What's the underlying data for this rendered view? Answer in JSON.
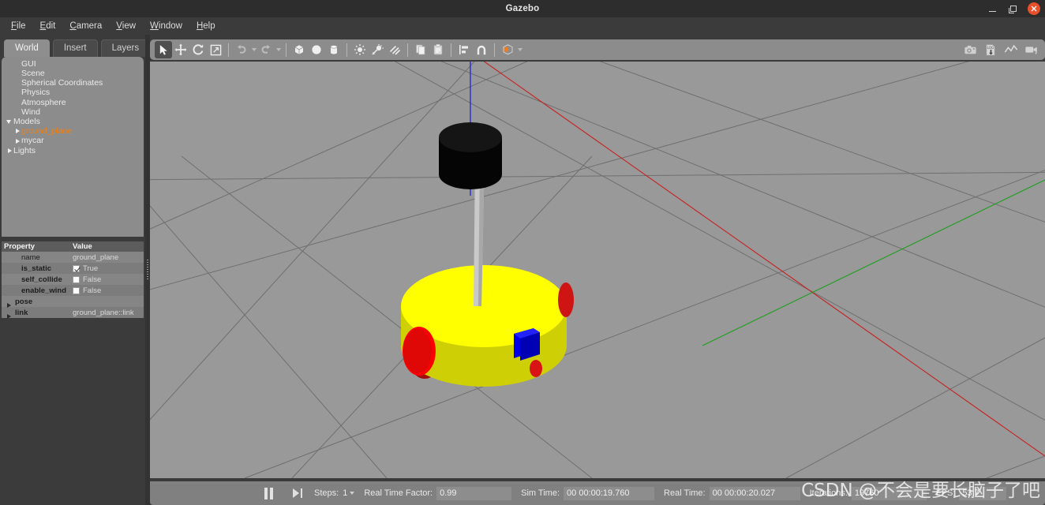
{
  "window": {
    "title": "Gazebo",
    "minimize_label": "Minimize",
    "maximize_label": "Maximize",
    "close_label": "Close"
  },
  "menu": {
    "items": [
      {
        "label": "File"
      },
      {
        "label": "Edit"
      },
      {
        "label": "Camera"
      },
      {
        "label": "View"
      },
      {
        "label": "Window"
      },
      {
        "label": "Help"
      }
    ]
  },
  "sidebar": {
    "tabs": [
      {
        "label": "World",
        "active": true
      },
      {
        "label": "Insert",
        "active": false
      },
      {
        "label": "Layers",
        "active": false
      }
    ],
    "tree": [
      {
        "label": "GUI",
        "indent": 1,
        "arrow": "none",
        "selected": false
      },
      {
        "label": "Scene",
        "indent": 1,
        "arrow": "none",
        "selected": false
      },
      {
        "label": "Spherical Coordinates",
        "indent": 1,
        "arrow": "none",
        "selected": false
      },
      {
        "label": "Physics",
        "indent": 1,
        "arrow": "none",
        "selected": false
      },
      {
        "label": "Atmosphere",
        "indent": 1,
        "arrow": "none",
        "selected": false
      },
      {
        "label": "Wind",
        "indent": 1,
        "arrow": "none",
        "selected": false
      },
      {
        "label": "Models",
        "indent": 0,
        "arrow": "down",
        "selected": false
      },
      {
        "label": "ground_plane",
        "indent": 1,
        "arrow": "right",
        "selected": true
      },
      {
        "label": "mycar",
        "indent": 1,
        "arrow": "right",
        "selected": false
      },
      {
        "label": "Lights",
        "indent": 0,
        "arrow": "right",
        "selected": false
      }
    ],
    "property_headers": {
      "property": "Property",
      "value": "Value"
    },
    "properties": [
      {
        "name": "name",
        "value": "ground_plane",
        "kind": "text",
        "bold": false
      },
      {
        "name": "is_static",
        "value": "True",
        "kind": "check",
        "checked": true,
        "bold": true
      },
      {
        "name": "self_collide",
        "value": "False",
        "kind": "check",
        "checked": false,
        "bold": true
      },
      {
        "name": "enable_wind",
        "value": "False",
        "kind": "check",
        "checked": false,
        "bold": true
      },
      {
        "name": "pose",
        "value": "",
        "kind": "expand",
        "bold": true
      },
      {
        "name": "link",
        "value": "ground_plane::link",
        "kind": "expand",
        "bold": true
      }
    ]
  },
  "toolbar": {
    "left_tools": [
      {
        "name": "select-mode",
        "icon": "cursor-arrow-icon",
        "active": true
      },
      {
        "name": "translate-mode",
        "icon": "move-arrows-icon",
        "active": false
      },
      {
        "name": "rotate-mode",
        "icon": "rotate-icon",
        "active": false
      },
      {
        "name": "scale-mode",
        "icon": "scale-icon",
        "active": false
      }
    ],
    "history_tools": [
      {
        "name": "undo",
        "icon": "undo-arrow-icon"
      },
      {
        "name": "redo",
        "icon": "redo-arrow-icon"
      }
    ],
    "shape_tools": [
      {
        "name": "insert-box",
        "icon": "box-icon"
      },
      {
        "name": "insert-sphere",
        "icon": "sphere-icon"
      },
      {
        "name": "insert-cylinder",
        "icon": "cylinder-icon"
      }
    ],
    "light_tools": [
      {
        "name": "point-light",
        "icon": "point-light-icon"
      },
      {
        "name": "spot-light",
        "icon": "spot-light-icon"
      },
      {
        "name": "directional-light",
        "icon": "directional-light-icon"
      }
    ],
    "clipboard_tools": [
      {
        "name": "copy",
        "icon": "copy-icon"
      },
      {
        "name": "paste",
        "icon": "paste-icon"
      }
    ],
    "align_tools": [
      {
        "name": "align",
        "icon": "align-icon"
      },
      {
        "name": "snap",
        "icon": "magnet-icon"
      }
    ],
    "view_tools": [
      {
        "name": "view-angle",
        "icon": "view-cube-icon",
        "accent": "#f07c1e"
      }
    ],
    "right_tools": [
      {
        "name": "screenshot",
        "icon": "camera-icon"
      },
      {
        "name": "log-record",
        "icon": "log-download-icon",
        "badge": "LOG"
      },
      {
        "name": "plot",
        "icon": "plot-line-icon"
      },
      {
        "name": "video-record",
        "icon": "video-camera-icon"
      }
    ]
  },
  "statusbar": {
    "pause_label": "Pause",
    "step_forward_label": "Step",
    "steps_label": "Steps:",
    "steps_value": "1",
    "real_time_factor_label": "Real Time Factor:",
    "real_time_factor_value": "0.99",
    "sim_time_label": "Sim Time:",
    "sim_time_value": "00 00:00:19.760",
    "real_time_label": "Real Time:",
    "real_time_value": "00 00:00:20.027",
    "iterations_label": "Iterations:",
    "iterations_value": "19760",
    "fps_label": "FPS:",
    "fps_value": "53.7"
  },
  "watermark": {
    "text": "CSDN @不会是要长脑子了吧"
  },
  "scene": {
    "ground_color": "#999999",
    "grid_color": "#6e6e6e",
    "axis_x_color": "#dd2222",
    "axis_y_color": "#22aa22",
    "axis_z_color": "#2222dd",
    "model_name": "mycar",
    "parts": [
      {
        "name": "chassis-cylinder",
        "color": "#ffff00",
        "shade": "#cccc00"
      },
      {
        "name": "left-wheel",
        "color": "#ff0000",
        "shade": "#aa0000"
      },
      {
        "name": "right-wheel",
        "color": "#ff0000",
        "shade": "#aa0000"
      },
      {
        "name": "caster-sphere",
        "color": "#dd1111"
      },
      {
        "name": "camera-sensor-box",
        "color": "#0000ee",
        "shade": "#0000aa"
      },
      {
        "name": "lidar-pole",
        "color": "#cccccc",
        "shade": "#9a9a9a"
      },
      {
        "name": "lidar-cylinder",
        "color": "#0a0a0a",
        "shade": "#000000"
      }
    ]
  }
}
